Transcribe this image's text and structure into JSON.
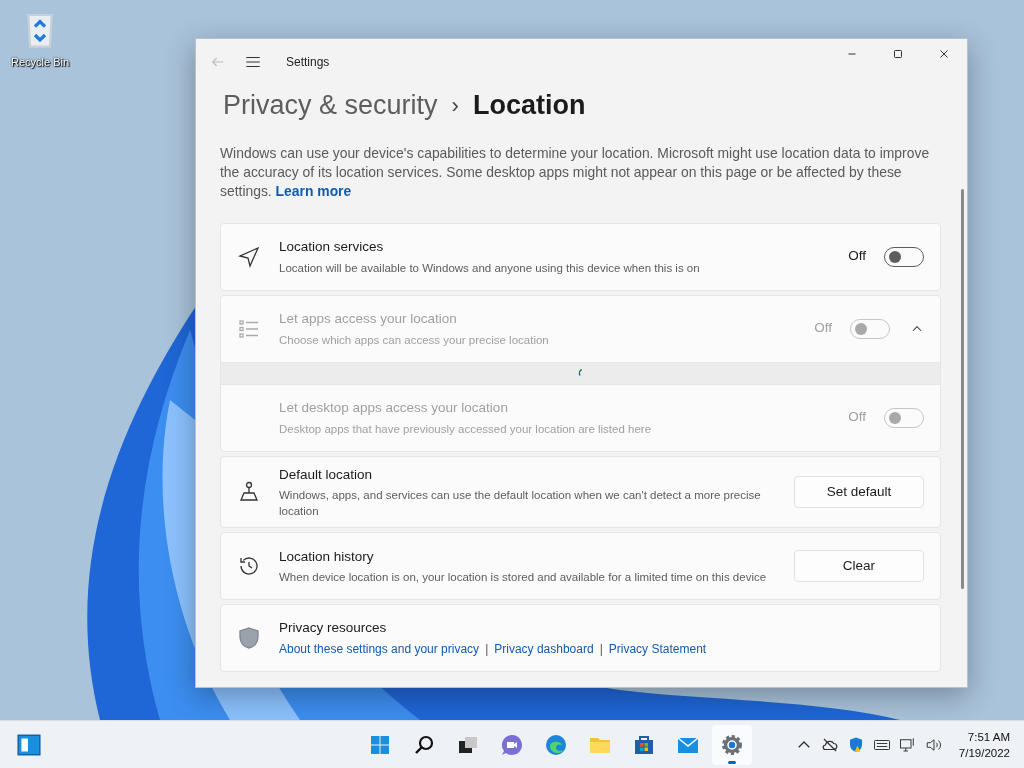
{
  "desktop_icons": [
    {
      "label": "Recycle Bin"
    }
  ],
  "window": {
    "title": "Settings"
  },
  "breadcrumb": {
    "parent": "Privacy & security",
    "separator": "›",
    "current": "Location"
  },
  "description": {
    "text": "Windows can use your device's capabilities to determine your location. Microsoft might use location data to improve the accuracy of its location services. Some desktop apps might not appear on this page or be affected by these settings.",
    "link": "Learn more"
  },
  "settings": [
    {
      "kind": "toggle",
      "title": "Location services",
      "subtitle": "Location will be available to Windows and anyone using this device when this is on",
      "state_label": "Off",
      "on": false,
      "disabled": false
    },
    {
      "kind": "expander",
      "title": "Let apps access your location",
      "subtitle": "Choose which apps can access your precise location",
      "state_label": "Off",
      "on": false,
      "disabled": true,
      "expanded": true,
      "loading": true
    },
    {
      "kind": "subtoggle",
      "title": "Let desktop apps access your location",
      "subtitle": "Desktop apps that have previously accessed your location are listed here",
      "state_label": "Off",
      "on": false,
      "disabled": true
    },
    {
      "kind": "button",
      "title": "Default location",
      "subtitle": "Windows, apps, and services can use the default location when we can't detect a more precise location",
      "button": "Set default"
    },
    {
      "kind": "button",
      "title": "Location history",
      "subtitle": "When device location is on, your location is stored and available for a limited time on this device",
      "button": "Clear"
    },
    {
      "kind": "links",
      "title": "Privacy resources",
      "link_separator": "|",
      "links": [
        "About these settings and your privacy",
        "Privacy dashboard",
        "Privacy Statement"
      ]
    }
  ],
  "taskbar": {
    "apps": [
      {
        "selected": false
      },
      {
        "selected": false
      },
      {
        "selected": false
      },
      {
        "selected": false
      },
      {
        "selected": false
      },
      {
        "selected": false
      },
      {
        "selected": false
      },
      {
        "selected": false
      },
      {
        "selected": true
      }
    ],
    "time": "7:51 AM",
    "date": "7/19/2022"
  }
}
